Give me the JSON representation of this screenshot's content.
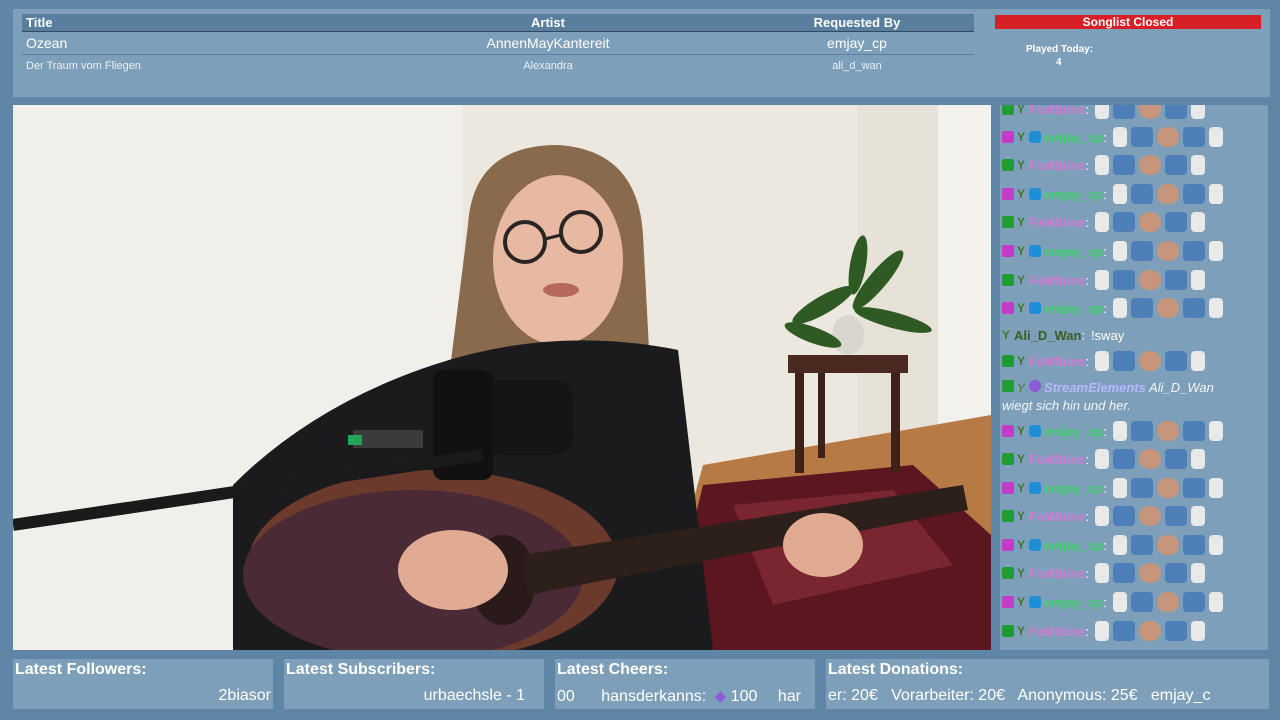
{
  "songlist": {
    "headers": {
      "title": "Title",
      "artist": "Artist",
      "requested_by": "Requested By"
    },
    "current": {
      "title": "Ozean",
      "artist": "AnnenMayKantereit",
      "requested_by": "emjay_cp"
    },
    "next": {
      "title": "Der Traum vom Fliegen",
      "artist": "Alexandra",
      "requested_by": "ali_d_wan"
    },
    "status": "Songlist Closed",
    "played_label": "Played Today:",
    "played_count": "4"
  },
  "chat": {
    "lines": [
      {
        "user": "FaMIbine",
        "colon": ":"
      },
      {
        "user": "emjay_cp",
        "colon": ":"
      },
      {
        "user": "FaMIbine",
        "colon": ":"
      },
      {
        "user": "emjay_cp",
        "colon": ":"
      },
      {
        "user": "FaMIbine",
        "colon": ":"
      },
      {
        "user": "emjay_cp",
        "colon": ":"
      },
      {
        "user": "FaMIbine",
        "colon": ":"
      },
      {
        "user": "emjay_cp",
        "colon": ":"
      },
      {
        "user": "Ali_D_Wan",
        "colon": ":",
        "message": "!sway"
      },
      {
        "user": "FaMIbine",
        "colon": ":"
      },
      {
        "user": "StreamElements",
        "message_a": "Ali_D_Wan",
        "message_b": "wiegt sich hin und her."
      },
      {
        "user": "emjay_cp",
        "colon": ":"
      },
      {
        "user": "FaMIbine",
        "colon": ":"
      },
      {
        "user": "emjay_cp",
        "colon": ":"
      },
      {
        "user": "FaMIbine",
        "colon": ":"
      },
      {
        "user": "emjay_cp",
        "colon": ":"
      },
      {
        "user": "FaMIbine",
        "colon": ":"
      },
      {
        "user": "emjay_cp",
        "colon": ":"
      },
      {
        "user": "FaMIbine",
        "colon": ":"
      }
    ]
  },
  "widgets": {
    "followers": {
      "title": "Latest Followers:",
      "value": "2biasor"
    },
    "subscribers": {
      "title": "Latest Subscribers:",
      "value": "urbaechsle - 1"
    },
    "cheers": {
      "title": "Latest Cheers:",
      "prefix": "00",
      "user": "hansderkanns:",
      "amount": "100",
      "trail": "har"
    },
    "donations": {
      "title": "Latest Donations:",
      "ticker": "er: 20€   Vorarbeiter: 20€   Anonymous: 25€   emjay_c"
    }
  },
  "colors": {
    "status_red": "#d61f26",
    "panel": "#7e9fb9",
    "background": "#5f86a6"
  }
}
